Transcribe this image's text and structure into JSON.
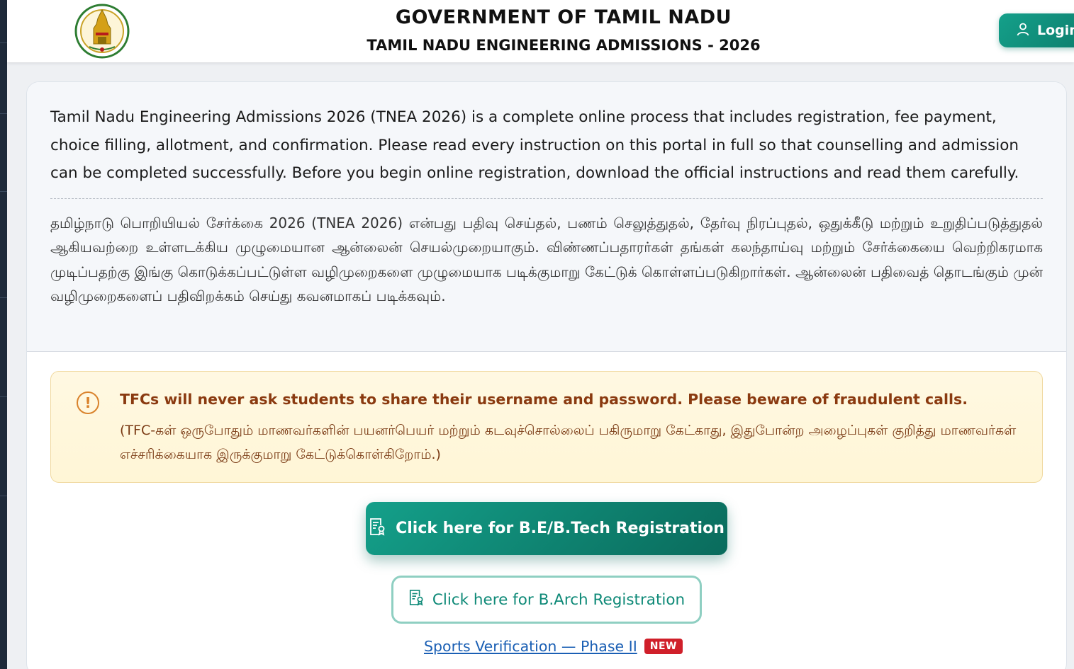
{
  "header": {
    "gov_title": "GOVERNMENT OF TAMIL NADU",
    "admissions_title": "TAMIL NADU ENGINEERING ADMISSIONS - 2026",
    "login_label": "Login"
  },
  "intro": {
    "english": "Tamil Nadu Engineering Admissions 2026 (TNEA 2026) is a complete online process that includes registration, fee payment, choice filling, allotment, and confirmation. Please read every instruction on this portal in full so that counselling and admission can be completed successfully. Before you begin online registration, download the official instructions and read them carefully.",
    "tamil": "தமிழ்நாடு பொறியியல் சேர்க்கை 2026 (TNEA 2026) என்பது பதிவு செய்தல், பணம் செலுத்துதல், தேர்வு நிரப்புதல், ஒதுக்கீடு மற்றும் உறுதிப்படுத்துதல் ஆகியவற்றை உள்ளடக்கிய முழுமையான ஆன்லைன் செயல்முறையாகும். விண்ணப்பதாரர்கள் தங்கள் கலந்தாய்வு மற்றும் சேர்க்கையை வெற்றிகரமாக முடிப்பதற்கு இங்கு கொடுக்கப்பட்டுள்ள வழிமுறைகளை முழுமையாக படிக்குமாறு கேட்டுக் கொள்ளப்படுகிறார்கள். ஆன்லைன் பதிவைத் தொடங்கும் முன் வழிமுறைகளைப் பதிவிறக்கம் செய்து கவனமாகப் படிக்கவும்."
  },
  "warning": {
    "icon": "exclamation-circle-icon",
    "english": "TFCs will never ask students to share their username and password. Please beware of fraudulent calls.",
    "tamil": "(TFC-கள் ஒருபோதும் மாணவர்களின் பயனர்பெயர் மற்றும் கடவுச்சொல்லைப் பகிருமாறு கேட்காது, இதுபோன்ற அழைப்புகள் குறித்து மாணவர்கள் எச்சரிக்கையாக இருக்குமாறு கேட்டுக்கொள்கிறோம்.)"
  },
  "actions": {
    "be_btech_label": "Click here for B.E/B.Tech Registration",
    "barch_label": "Click here for B.Arch Registration",
    "sports_link": "Sports Verification — Phase II",
    "new_badge": "NEW"
  },
  "colors": {
    "accent": "#14a08a",
    "accent_dark": "#0a6b5c",
    "warning_bg": "#fff8e2",
    "warning_text": "#8a3a10",
    "badge_red": "#d01f2a",
    "link_blue": "#1a5fb4"
  }
}
